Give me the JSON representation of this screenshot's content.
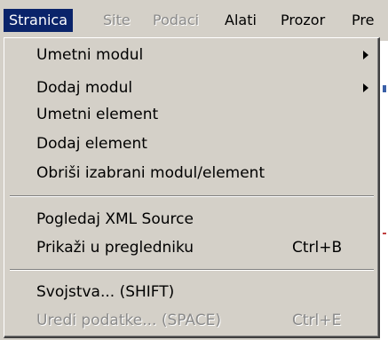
{
  "menubar": {
    "items": [
      {
        "label": "Stranica",
        "state": "active"
      },
      {
        "label": "Site",
        "state": "disabled"
      },
      {
        "label": "Podaci",
        "state": "disabled"
      },
      {
        "label": "Alati",
        "state": "normal"
      },
      {
        "label": "Prozor",
        "state": "normal"
      },
      {
        "label": "Pre",
        "state": "normal"
      }
    ]
  },
  "menu": {
    "items": [
      {
        "label": "Umetni modul",
        "submenu": true
      },
      {
        "label": "Dodaj modul",
        "submenu": true
      },
      {
        "label": "Umetni element"
      },
      {
        "label": "Dodaj element"
      },
      {
        "label": "Obriši izabrani modul/element"
      },
      {
        "label": "Pogledaj XML Source"
      },
      {
        "label": "Prikaži u pregledniku",
        "shortcut": "Ctrl+B"
      },
      {
        "label": "Svojstva... (SHIFT)"
      },
      {
        "label": "Uredi podatke... (SPACE)",
        "shortcut": "Ctrl+E",
        "disabled": true
      }
    ]
  },
  "colors": {
    "menu_bg": "#d4d0c8",
    "highlight": "#0a246a",
    "disabled_text": "#8a8a8a"
  }
}
